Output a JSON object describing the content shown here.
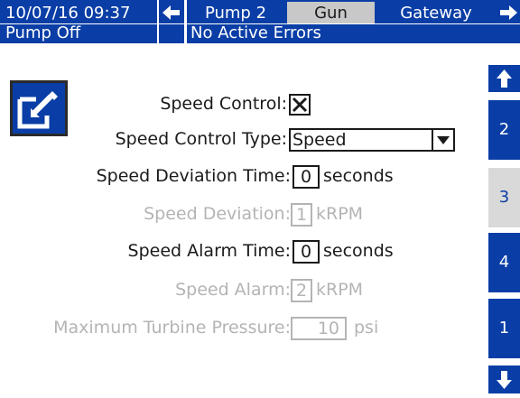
{
  "header": {
    "datetime": "10/07/16 09:37",
    "tabs": [
      {
        "label": "Pump 2",
        "active": false
      },
      {
        "label": "Gun",
        "active": true
      },
      {
        "label": "Gateway",
        "active": false
      }
    ],
    "pump_status": "Pump Off",
    "error_status": "No Active Errors"
  },
  "side_nav": {
    "pages": [
      "2",
      "3",
      "4",
      "1"
    ],
    "current_page": "3"
  },
  "form": {
    "speed_control": {
      "label": "Speed Control:",
      "checked": true
    },
    "speed_control_type": {
      "label": "Speed Control Type:",
      "value": "Speed"
    },
    "speed_deviation_time": {
      "label": "Speed Deviation Time:",
      "value": "0",
      "unit": "seconds"
    },
    "speed_deviation": {
      "label": "Speed Deviation:",
      "value": "1",
      "unit": "kRPM",
      "enabled": false
    },
    "speed_alarm_time": {
      "label": "Speed Alarm Time:",
      "value": "0",
      "unit": "seconds"
    },
    "speed_alarm": {
      "label": "Speed Alarm:",
      "value": "2",
      "unit": "kRPM",
      "enabled": false
    },
    "max_turbine_pressure": {
      "label": "Maximum Turbine Pressure:",
      "value": "10",
      "unit": "psi",
      "enabled": false
    }
  },
  "colors": {
    "primary_blue": "#0a3ea6",
    "active_tab": "#c8c8c8",
    "disabled_text": "#b4b4b4"
  },
  "icons": [
    "arrow-left-icon",
    "arrow-right-icon",
    "arrow-up-icon",
    "arrow-down-icon",
    "edit-icon",
    "checkbox-checked-icon",
    "dropdown-arrow-icon"
  ]
}
